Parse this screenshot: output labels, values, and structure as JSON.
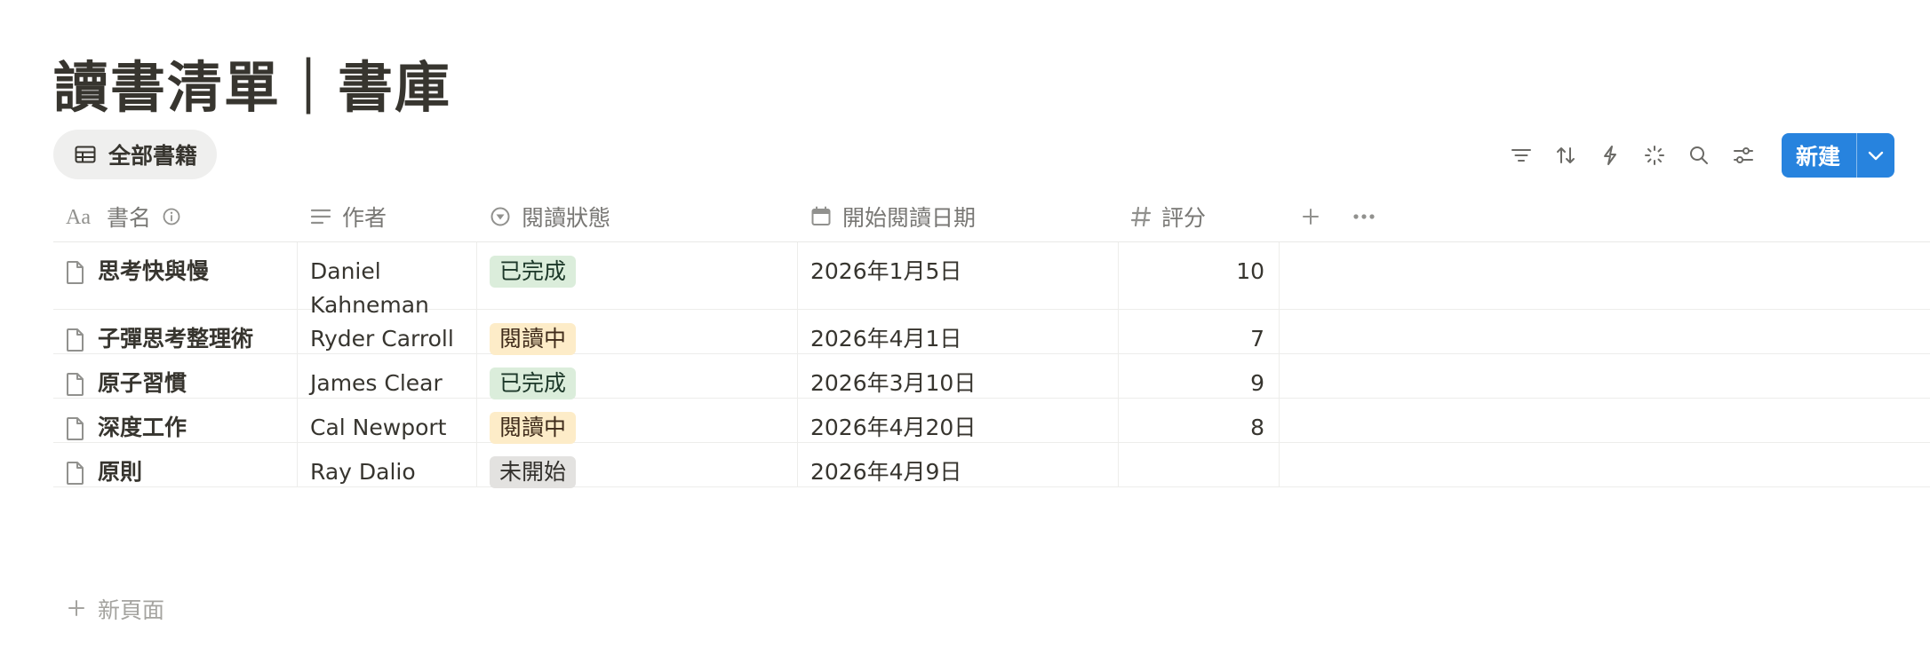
{
  "page": {
    "title": "讀書清單｜書庫"
  },
  "view_tab": {
    "label": "全部書籍",
    "icon": "table-icon"
  },
  "toolbar": {
    "icons": [
      "filter-icon",
      "sort-icon",
      "automation-icon",
      "ai-sparkle-icon",
      "search-icon",
      "settings-sliders-icon"
    ],
    "new_label": "新建",
    "accent": "#2783de"
  },
  "columns": {
    "name": "書名",
    "author": "作者",
    "status": "閱讀狀態",
    "date": "開始閱讀日期",
    "score": "評分"
  },
  "status_colors": {
    "已完成": {
      "bg": "#dbeddb",
      "fg": "#1c3829"
    },
    "閱讀中": {
      "bg": "#fdecc8",
      "fg": "#402c1b"
    },
    "未開始": {
      "bg": "#e3e2e0",
      "fg": "#32302c"
    }
  },
  "rows": [
    {
      "name": "思考快與慢",
      "author": "Daniel Kahneman",
      "status": "已完成",
      "date": "2026年1月5日",
      "score": "10"
    },
    {
      "name": "子彈思考整理術",
      "author": "Ryder Carroll",
      "status": "閱讀中",
      "date": "2026年4月1日",
      "score": "7"
    },
    {
      "name": "原子習慣",
      "author": "James Clear",
      "status": "已完成",
      "date": "2026年3月10日",
      "score": "9"
    },
    {
      "name": "深度工作",
      "author": "Cal Newport",
      "status": "閱讀中",
      "date": "2026年4月20日",
      "score": "8"
    },
    {
      "name": "原則",
      "author": "Ray Dalio",
      "status": "未開始",
      "date": "2026年4月9日",
      "score": ""
    }
  ],
  "add_row": {
    "label": "新頁面"
  }
}
